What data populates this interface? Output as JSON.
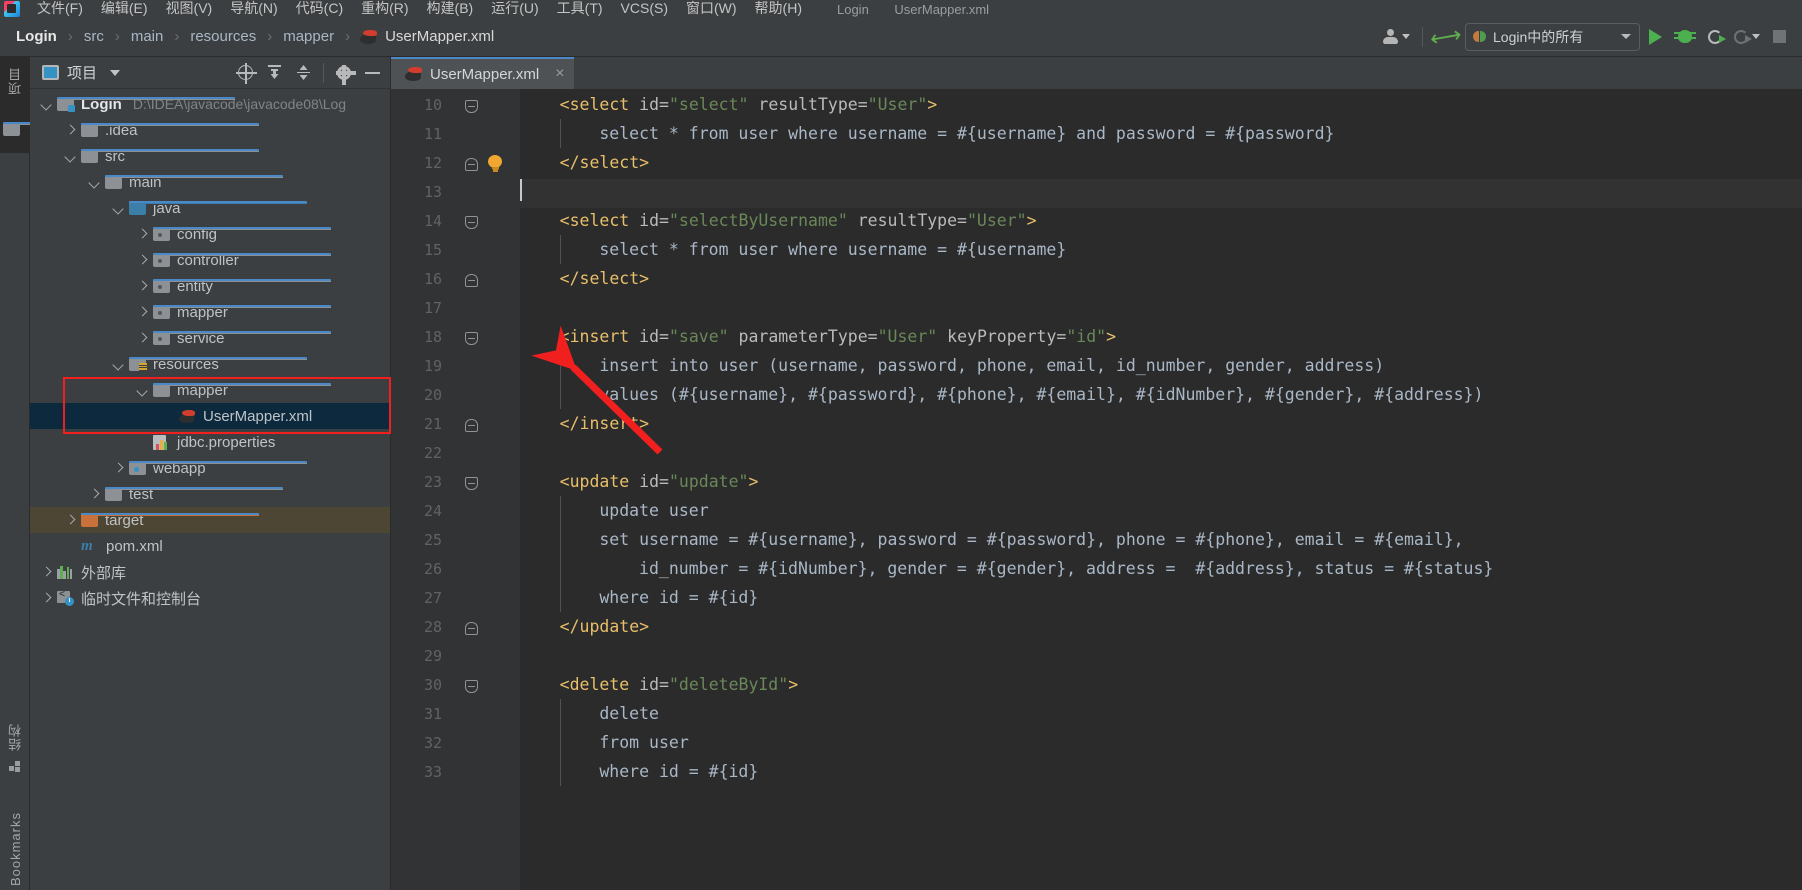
{
  "menu": {
    "items": [
      "文件(F)",
      "编辑(E)",
      "视图(V)",
      "导航(N)",
      "代码(C)",
      "重构(R)",
      "构建(B)",
      "运行(U)",
      "工具(T)",
      "VCS(S)",
      "窗口(W)",
      "帮助(H)"
    ],
    "trail": [
      "Login",
      "UserMapper.xml"
    ]
  },
  "breadcrumb": {
    "root": "Login",
    "parts": [
      "src",
      "main",
      "resources",
      "mapper"
    ],
    "file": "UserMapper.xml",
    "separator": "›"
  },
  "toolbar": {
    "profile_label": "profile-icon",
    "build_label": "build-icon",
    "run_config": "Login中的所有",
    "run_label": "run-icon",
    "debug_label": "debug-icon",
    "run_with_coverage_label": "run-with-coverage-icon",
    "profiler_label": "profiler-icon",
    "stop_label": "stop-icon"
  },
  "activitybar": {
    "project_label": "项目",
    "structure_label": "结构",
    "bookmarks_label": "Bookmarks"
  },
  "project_panel": {
    "title": "项目",
    "tools": [
      "select-opened-file-icon",
      "expand-all-icon",
      "collapse-all-icon",
      "settings-icon",
      "hide-icon"
    ],
    "tree": [
      {
        "depth": 0,
        "label": "Login",
        "path": "D:\\IDEA\\javacode\\javacode08\\Log",
        "icon": "project-folder",
        "arrow": "down",
        "bold": true
      },
      {
        "depth": 1,
        "label": ".idea",
        "icon": "folder",
        "arrow": "right"
      },
      {
        "depth": 1,
        "label": "src",
        "icon": "folder",
        "arrow": "down"
      },
      {
        "depth": 2,
        "label": "main",
        "icon": "folder",
        "arrow": "down"
      },
      {
        "depth": 3,
        "label": "java",
        "icon": "source-folder",
        "arrow": "down"
      },
      {
        "depth": 4,
        "label": "config",
        "icon": "package",
        "arrow": "right"
      },
      {
        "depth": 4,
        "label": "controller",
        "icon": "package",
        "arrow": "right"
      },
      {
        "depth": 4,
        "label": "entity",
        "icon": "package",
        "arrow": "right"
      },
      {
        "depth": 4,
        "label": "mapper",
        "icon": "package",
        "arrow": "right"
      },
      {
        "depth": 4,
        "label": "service",
        "icon": "package",
        "arrow": "right"
      },
      {
        "depth": 3,
        "label": "resources",
        "icon": "resource-folder",
        "arrow": "down"
      },
      {
        "depth": 4,
        "label": "mapper",
        "icon": "folder",
        "arrow": "down"
      },
      {
        "depth": 5,
        "label": "UserMapper.xml",
        "icon": "mybatis-file",
        "arrow": "none",
        "selected": true
      },
      {
        "depth": 4,
        "label": "jdbc.properties",
        "icon": "properties-file",
        "arrow": "none"
      },
      {
        "depth": 3,
        "label": "webapp",
        "icon": "webapp-folder",
        "arrow": "right"
      },
      {
        "depth": 2,
        "label": "test",
        "icon": "folder",
        "arrow": "right"
      },
      {
        "depth": 1,
        "label": "target",
        "icon": "excluded-folder",
        "arrow": "right",
        "highlighted": true
      },
      {
        "depth": 1,
        "label": "pom.xml",
        "icon": "maven-file",
        "arrow": "none"
      },
      {
        "depth": 0,
        "label": "外部库",
        "icon": "library",
        "arrow": "right"
      },
      {
        "depth": 0,
        "label": "临时文件和控制台",
        "icon": "scratches",
        "arrow": "right"
      }
    ]
  },
  "editor": {
    "tab": {
      "label": "UserMapper.xml",
      "close": "×",
      "icon": "mybatis-file-icon"
    },
    "first_line_number": 10,
    "caret_line": 13,
    "lines": [
      {
        "n": 10,
        "indent": 1,
        "fold": "top",
        "tokens": [
          {
            "t": "tag",
            "v": "<select "
          },
          {
            "t": "attr",
            "v": "id="
          },
          {
            "t": "str",
            "v": "\"select\""
          },
          {
            "t": "attr",
            "v": " resultType="
          },
          {
            "t": "str",
            "v": "\"User\""
          },
          {
            "t": "tag",
            "v": ">"
          }
        ]
      },
      {
        "n": 11,
        "indent": 2,
        "tokens": [
          {
            "t": "txt",
            "v": "select * from user where username = #{username} and password = #{password}"
          }
        ]
      },
      {
        "n": 12,
        "indent": 1,
        "fold": "bot",
        "bulb": true,
        "tokens": [
          {
            "t": "tag",
            "v": "</select>"
          }
        ]
      },
      {
        "n": 13,
        "indent": 0,
        "caret": true,
        "tokens": []
      },
      {
        "n": 14,
        "indent": 1,
        "fold": "top",
        "tokens": [
          {
            "t": "tag",
            "v": "<select "
          },
          {
            "t": "attr",
            "v": "id="
          },
          {
            "t": "str",
            "v": "\"selectByUsername\""
          },
          {
            "t": "attr",
            "v": " resultType="
          },
          {
            "t": "str",
            "v": "\"User\""
          },
          {
            "t": "tag",
            "v": ">"
          }
        ]
      },
      {
        "n": 15,
        "indent": 2,
        "tokens": [
          {
            "t": "txt",
            "v": "select * from user where username = #{username}"
          }
        ]
      },
      {
        "n": 16,
        "indent": 1,
        "fold": "bot",
        "tokens": [
          {
            "t": "tag",
            "v": "</select>"
          }
        ]
      },
      {
        "n": 17,
        "indent": 0,
        "tokens": []
      },
      {
        "n": 18,
        "indent": 1,
        "fold": "top",
        "tokens": [
          {
            "t": "tag",
            "v": "<insert "
          },
          {
            "t": "attr",
            "v": "id="
          },
          {
            "t": "str",
            "v": "\"save\""
          },
          {
            "t": "attr",
            "v": " parameterType="
          },
          {
            "t": "str",
            "v": "\"User\""
          },
          {
            "t": "attr",
            "v": " keyProperty="
          },
          {
            "t": "str",
            "v": "\"id\""
          },
          {
            "t": "tag",
            "v": ">"
          }
        ]
      },
      {
        "n": 19,
        "indent": 2,
        "tokens": [
          {
            "t": "txt",
            "v": "insert into user (username, password, phone, email, id_number, gender, address)"
          }
        ]
      },
      {
        "n": 20,
        "indent": 2,
        "tokens": [
          {
            "t": "txt",
            "v": "values (#{username}, #{password}, #{phone}, #{email}, #{idNumber}, #{gender}, #{address})"
          }
        ]
      },
      {
        "n": 21,
        "indent": 1,
        "fold": "bot",
        "tokens": [
          {
            "t": "tag",
            "v": "</insert>"
          }
        ]
      },
      {
        "n": 22,
        "indent": 0,
        "tokens": []
      },
      {
        "n": 23,
        "indent": 1,
        "fold": "top",
        "tokens": [
          {
            "t": "tag",
            "v": "<update "
          },
          {
            "t": "attr",
            "v": "id="
          },
          {
            "t": "str",
            "v": "\"update\""
          },
          {
            "t": "tag",
            "v": ">"
          }
        ]
      },
      {
        "n": 24,
        "indent": 2,
        "tokens": [
          {
            "t": "txt",
            "v": "update user"
          }
        ]
      },
      {
        "n": 25,
        "indent": 2,
        "tokens": [
          {
            "t": "txt",
            "v": "set username = #{username}, password = #{password}, phone = #{phone}, email = #{email},"
          }
        ]
      },
      {
        "n": 26,
        "indent": 3,
        "tokens": [
          {
            "t": "txt",
            "v": "id_number = #{idNumber}, gender = #{gender}, address =  #{address}, status = #{status}"
          }
        ]
      },
      {
        "n": 27,
        "indent": 2,
        "tokens": [
          {
            "t": "txt",
            "v": "where id = #{id}"
          }
        ]
      },
      {
        "n": 28,
        "indent": 1,
        "fold": "bot",
        "tokens": [
          {
            "t": "tag",
            "v": "</update>"
          }
        ]
      },
      {
        "n": 29,
        "indent": 0,
        "tokens": []
      },
      {
        "n": 30,
        "indent": 1,
        "fold": "top",
        "tokens": [
          {
            "t": "tag",
            "v": "<delete "
          },
          {
            "t": "attr",
            "v": "id="
          },
          {
            "t": "str",
            "v": "\"deleteById\""
          },
          {
            "t": "tag",
            "v": ">"
          }
        ]
      },
      {
        "n": 31,
        "indent": 2,
        "tokens": [
          {
            "t": "txt",
            "v": "delete"
          }
        ]
      },
      {
        "n": 32,
        "indent": 2,
        "tokens": [
          {
            "t": "txt",
            "v": "from user"
          }
        ]
      },
      {
        "n": 33,
        "indent": 2,
        "tokens": [
          {
            "t": "txt",
            "v": "where id = #{id}"
          }
        ]
      }
    ]
  },
  "annotations": {
    "highlight_color": "#f21f1f",
    "box_label": "mapper-usermapper-highlight",
    "arrow_label": "pointer-arrow"
  }
}
